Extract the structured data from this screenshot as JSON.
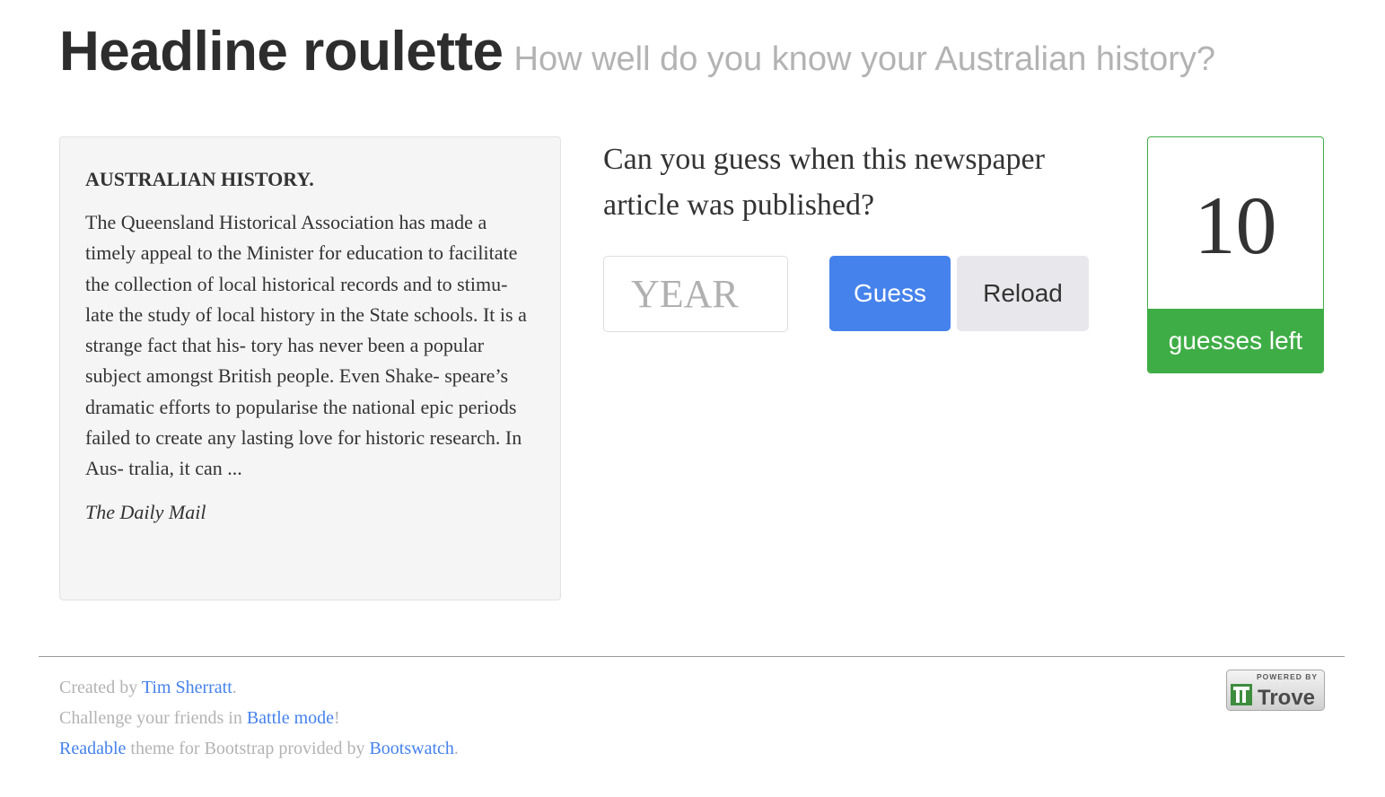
{
  "header": {
    "title": "Headline roulette",
    "subtitle": "How well do you know your Australian history?"
  },
  "article": {
    "heading": "AUSTRALIAN HISTORY.",
    "body": "The Queensland Historical Association has made a timely appeal to the Minister for education to facilitate the collection of local historical records and to stimu- late the study of local history in the State schools. It is a strange fact that his- tory has never been a popular subject amongst British people. Even Shake- speare’s dramatic efforts to popularise the national epic periods failed to create any lasting love for historic research. In Aus- tralia, it can ...",
    "source": "The Daily Mail"
  },
  "game": {
    "question": "Can you guess when this newspaper article was published?",
    "year_input": {
      "placeholder": "YEAR",
      "value": ""
    },
    "guess_label": "Guess",
    "reload_label": "Reload",
    "guesses_left": "10",
    "guesses_left_label": "guesses left"
  },
  "footer": {
    "line1": {
      "prefix": "Created by ",
      "link": "Tim Sherratt",
      "suffix": "."
    },
    "line2": {
      "prefix": "Challenge your friends in ",
      "link": "Battle mode",
      "suffix": "!"
    },
    "line3": {
      "link1": "Readable",
      "middle": " theme for Bootstrap provided by ",
      "link2": "Bootswatch",
      "suffix": "."
    },
    "badge": {
      "powered_by": "POWERED BY",
      "brand": "Trove"
    }
  },
  "colors": {
    "primary": "#4582ec",
    "success": "#3fad46",
    "muted": "#b3b3b3",
    "text": "#333333",
    "well_bg": "#f5f5f5"
  }
}
